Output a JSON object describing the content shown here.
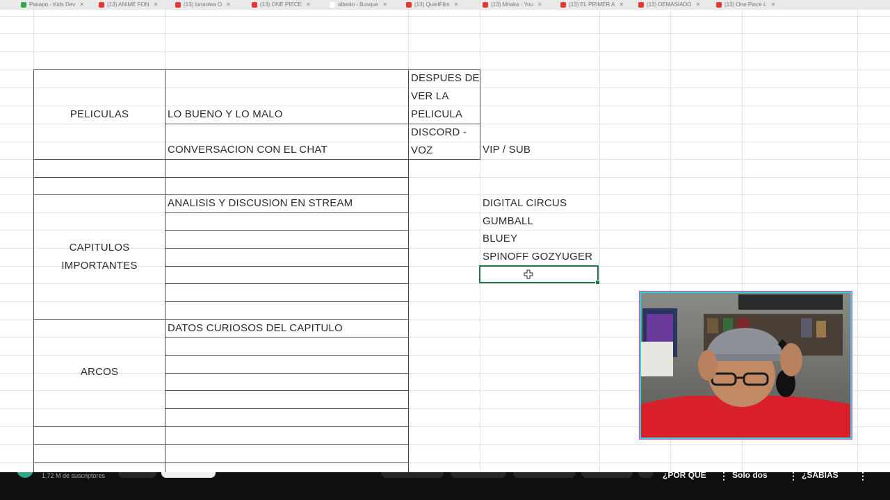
{
  "browser": {
    "tabs": [
      {
        "label": "Pasapo - Kids Dev",
        "color": "#3aa44a"
      },
      {
        "label": "(13) ANIME FON",
        "color": "#e53935"
      },
      {
        "label": "(13) lunaolea O",
        "color": "#e53935"
      },
      {
        "label": "(13) ONE PIECE",
        "color": "#e53935"
      },
      {
        "label": "albedo - Busque",
        "color": "#ffffff"
      },
      {
        "label": "(13) QuietFilm",
        "color": "#e53935"
      },
      {
        "label": "(13) Mhaka - You",
        "color": "#e53935"
      },
      {
        "label": "(13) EL PRIMER A",
        "color": "#e53935"
      },
      {
        "label": "(13) DEMASIADO",
        "color": "#e53935"
      },
      {
        "label": "(13) One Piece L",
        "color": "#e53935"
      }
    ]
  },
  "sheet": {
    "row1": {
      "a": "PELICULAS",
      "b": "LO BUENO Y LO MALO",
      "c": "DESPUES DE VER LA PELICULA"
    },
    "row2": {
      "b": "CONVERSACION CON EL CHAT",
      "c": "DISCORD - VOZ",
      "d": "VIP / SUB"
    },
    "row3": {
      "a": "CAPITULOS IMPORTANTES",
      "b": "ANALISIS Y DISCUSION EN STREAM"
    },
    "list": [
      "DIGITAL CIRCUS",
      "GUMBALL",
      "BLUEY",
      "SPINOFF GOZYUGER"
    ],
    "row4": {
      "a": "ARCOS",
      "b": "DATOS CURIOSOS DEL CAPITULO"
    }
  },
  "youtube_bar": {
    "subscribers": "1,72 M de suscriptores",
    "shorts": [
      "¿POR QUE",
      "Solo dos",
      "¿SABIAS"
    ]
  },
  "colors": {
    "selection": "#217346",
    "webcam_border": "#36d1d8"
  }
}
